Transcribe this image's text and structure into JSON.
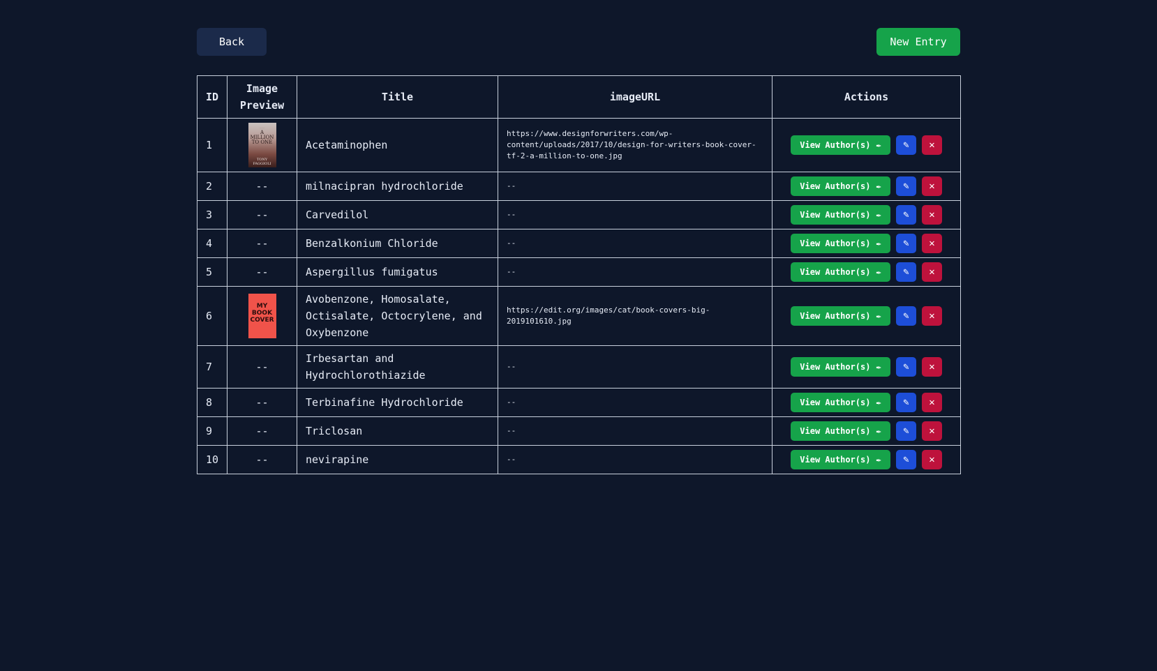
{
  "toolbar": {
    "back_label": "Back",
    "new_label": "New Entry"
  },
  "table": {
    "headers": {
      "id": "ID",
      "image_preview_line1": "Image",
      "image_preview_line2": "Preview",
      "title": "Title",
      "image_url": "imageURL",
      "actions": "Actions"
    },
    "view_authors_label": "View Author(s)",
    "rows": [
      {
        "id": "1",
        "title": "Acetaminophen",
        "image_url": "https://www.designforwriters.com/wp-content/uploads/2017/10/design-for-writers-book-cover-tf-2-a-million-to-one.jpg",
        "has_image": true
      },
      {
        "id": "2",
        "title": "milnacipran hydrochloride",
        "image_url": "--",
        "image_placeholder": "--"
      },
      {
        "id": "3",
        "title": "Carvedilol",
        "image_url": "--",
        "image_placeholder": "--"
      },
      {
        "id": "4",
        "title": "Benzalkonium Chloride",
        "image_url": "--",
        "image_placeholder": "--"
      },
      {
        "id": "5",
        "title": "Aspergillus fumigatus",
        "image_url": "--",
        "image_placeholder": "--"
      },
      {
        "id": "6",
        "title": "Avobenzone, Homosalate, Octisalate, Octocrylene, and Oxybenzone",
        "image_url": "https://edit.org/images/cat/book-covers-big-2019101610.jpg",
        "has_image": true
      },
      {
        "id": "7",
        "title": "Irbesartan and Hydrochlorothiazide",
        "image_url": "--",
        "image_placeholder": "--"
      },
      {
        "id": "8",
        "title": "Terbinafine Hydrochloride",
        "image_url": "--",
        "image_placeholder": "--"
      },
      {
        "id": "9",
        "title": "Triclosan",
        "image_url": "--",
        "image_placeholder": "--"
      },
      {
        "id": "10",
        "title": "nevirapine",
        "image_url": "--",
        "image_placeholder": "--"
      }
    ]
  },
  "covers": {
    "cover_1_lines": [
      "A",
      "MILLION",
      "TO ONE",
      "TONY",
      "FAGGIOLI"
    ],
    "cover_2_lines": [
      "MY",
      "BOOK",
      "COVER"
    ]
  },
  "colors": {
    "background": "#0e172a",
    "success": "#16a34a",
    "edit": "#1d4ed8",
    "delete": "#be123c"
  },
  "icons": {
    "view": "feather-icon",
    "edit": "edit-icon",
    "delete": "close-icon"
  }
}
